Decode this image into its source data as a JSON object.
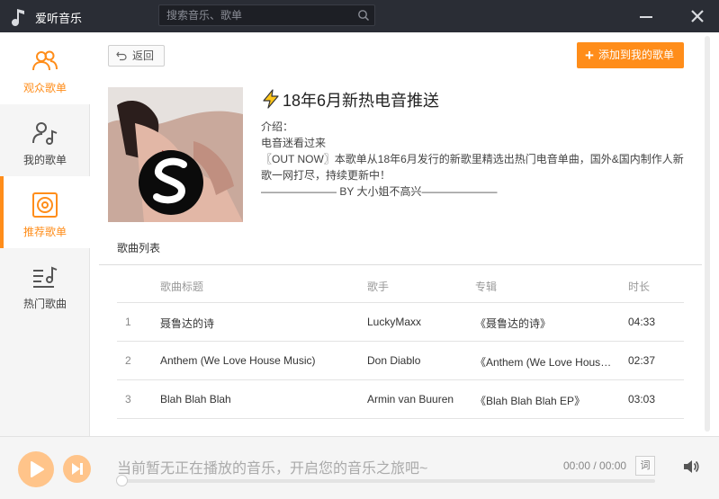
{
  "app": {
    "title": "爱听音乐"
  },
  "search": {
    "placeholder": "搜索音乐、歌单"
  },
  "sidebar": {
    "items": [
      {
        "label": "观众歌单",
        "icon": "users-icon"
      },
      {
        "label": "我的歌单",
        "icon": "user-music-icon"
      },
      {
        "label": "推荐歌单",
        "icon": "vinyl-icon"
      },
      {
        "label": "热门歌曲",
        "icon": "playlist-music-icon"
      }
    ]
  },
  "toolbar": {
    "back_label": "返回",
    "add_label": "添加到我的歌单"
  },
  "playlist": {
    "title": "18年6月新热电音推送",
    "intro_heading": "介绍：",
    "intro_lines": [
      "电音迷看过来",
      "〖OUT NOW〗本歌单从18年6月发行的新歌里精选出热门电音单曲，国外&国内制作人新",
      "歌一网打尽，持续更新中！",
      "——————— BY 大小姐不高兴———————"
    ]
  },
  "song_list": {
    "tab_label": "歌曲列表",
    "columns": {
      "title": "歌曲标题",
      "artist": "歌手",
      "album": "专辑",
      "duration": "时长"
    },
    "rows": [
      {
        "num": "1",
        "title": "聂鲁达的诗",
        "artist": "LuckyMaxx",
        "album": "《聂鲁达的诗》",
        "duration": "04:33"
      },
      {
        "num": "2",
        "title": "Anthem (We Love House Music)",
        "artist": "Don Diablo",
        "album": "《Anthem (We Love House Music)》",
        "duration": "02:37"
      },
      {
        "num": "3",
        "title": "Blah Blah Blah",
        "artist": "Armin van Buuren",
        "album": "《Blah Blah Blah EP》",
        "duration": "03:03"
      }
    ]
  },
  "player": {
    "now_playing": "当前暂无正在播放的音乐，开启您的音乐之旅吧~",
    "time": "00:00 / 00:00",
    "lyric_label": "词",
    "progress": 0
  },
  "colors": {
    "accent": "#ff8d1a",
    "titlebar": "#2a2d35"
  }
}
